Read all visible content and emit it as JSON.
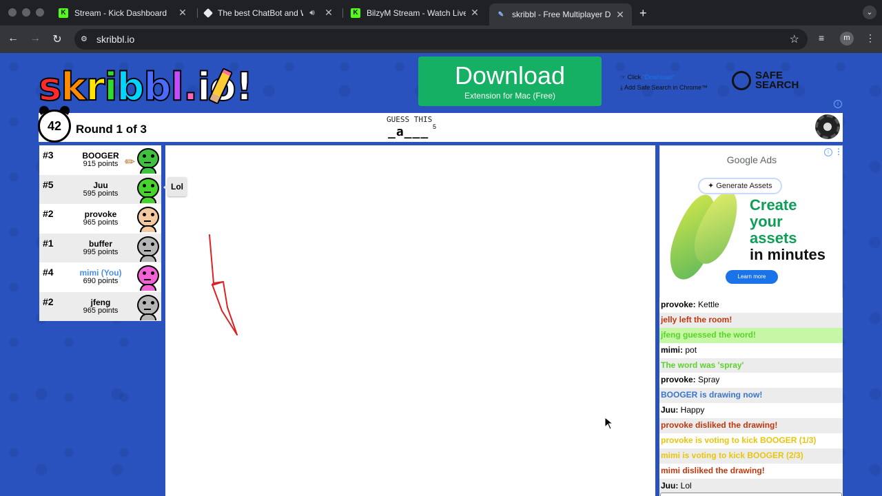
{
  "browser": {
    "tabs": [
      {
        "title": "Stream - Kick Dashboard",
        "icon": "kick-icon"
      },
      {
        "title": "The best ChatBot and Wi",
        "icon": "chatbot-icon"
      },
      {
        "title": "BilzyM Stream - Watch Live o",
        "icon": "kick-icon"
      },
      {
        "title": "skribbl - Free Multiplayer Dra",
        "icon": "skribbl-icon"
      }
    ],
    "url": "skribbl.io",
    "profile_initial": "m"
  },
  "banner": {
    "download_title": "Download",
    "download_sub": "Extension for Mac (Free)",
    "click_prefix": "Click ",
    "click_link": "\"Download\"",
    "add_note": "Add Safe Search in Chrome™",
    "safe_line1": "SAFE",
    "safe_line2": "SEARCH"
  },
  "game": {
    "timer": "42",
    "round": "Round 1 of 3",
    "guess_label": "GUESS THIS",
    "word_hint": "_a___",
    "word_length": "5"
  },
  "players": [
    {
      "rank": "#3",
      "name": "BOOGER",
      "points": "915 points",
      "color": "#3fc23f"
    },
    {
      "rank": "#5",
      "name": "Juu",
      "points": "595 points",
      "color": "#46d32b"
    },
    {
      "rank": "#2",
      "name": "provoke",
      "points": "965 points",
      "color": "#f2c9a0"
    },
    {
      "rank": "#1",
      "name": "buffer",
      "points": "995 points",
      "color": "#b5b5b5"
    },
    {
      "rank": "#4",
      "name": "mimi (You)",
      "points": "690 points",
      "color": "#f062d6"
    },
    {
      "rank": "#2",
      "name": "jfeng",
      "points": "965 points",
      "color": "#b5b5b5"
    }
  ],
  "speech_bubble": "Lol",
  "ad": {
    "brand": "Google Ads",
    "chip": "✦ Generate Assets",
    "headline_1": "Create",
    "headline_2": "your",
    "headline_3": "assets",
    "headline_4": "in minutes",
    "cta": "Learn more"
  },
  "chat": [
    {
      "user": "provoke:",
      "text": " Kettle",
      "style": "normal"
    },
    {
      "user": "",
      "text": "jelly left the room!",
      "style": "red"
    },
    {
      "user": "",
      "text": "jfeng guessed the word!",
      "style": "green-hl"
    },
    {
      "user": "mimi:",
      "text": " pot",
      "style": "normal"
    },
    {
      "user": "",
      "text": "The word was 'spray'",
      "style": "green"
    },
    {
      "user": "provoke:",
      "text": " Spray",
      "style": "normal"
    },
    {
      "user": "",
      "text": "BOOGER is drawing now!",
      "style": "blue"
    },
    {
      "user": "Juu:",
      "text": " Happy",
      "style": "normal"
    },
    {
      "user": "",
      "text": "provoke disliked the drawing!",
      "style": "red"
    },
    {
      "user": "",
      "text": "provoke is voting to kick BOOGER (1/3)",
      "style": "yellow"
    },
    {
      "user": "",
      "text": "mimi is voting to kick BOOGER (2/3)",
      "style": "yellow"
    },
    {
      "user": "",
      "text": "mimi disliked the drawing!",
      "style": "red"
    },
    {
      "user": "Juu:",
      "text": " Lol",
      "style": "normal"
    }
  ],
  "colors": {
    "page_bg": "#2a52be",
    "download_green": "#15b063",
    "stroke_red": "#e02020"
  }
}
